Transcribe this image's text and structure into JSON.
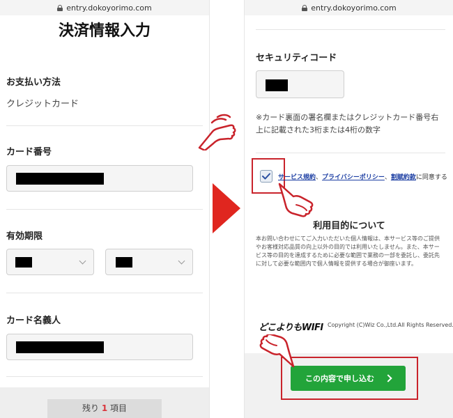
{
  "url": "entry.dokoyorimo.com",
  "left": {
    "title": "決済情報入力",
    "payment_method_label": "お支払い方法",
    "payment_method_value": "クレジットカード",
    "card_number_label": "カード番号",
    "expiry_label": "有効期限",
    "card_holder_label": "カード名義人",
    "remaining_prefix": "残り",
    "remaining_count": "1",
    "remaining_suffix": "項目"
  },
  "right": {
    "security_code_label": "セキュリティコード",
    "security_note": "※カード裏面の署名欄またはクレジットカード番号右上に記載された3桁または4桁の数字",
    "terms_link": "サービス規約",
    "privacy_link": "プライバシーポリシー",
    "cancel_link": "割賦約款",
    "separator": "、",
    "agree_suffix": "に同意する",
    "purpose_title": "利用目的について",
    "purpose_text": "本お問い合わせにてご入力いただいた個人情報は、本サービス等のご提供やお客様対応品質の向上以外の目的では利用いたしません。また、本サービス等の目的を達成するために必要な範囲で業務の一部を委託し、委託先に対して必要な範囲内で個人情報を提供する場合が御座います。",
    "logo_text": "どこよりもWIFI",
    "copyright": "Copyright (C)Wiz Co.,Ltd.All Rights Reserved.",
    "submit_label": "この内容で申し込む"
  },
  "colors": {
    "arrow_red": "#e0261f",
    "highlight_red": "#c9232b",
    "cta_green": "#22a43a",
    "link_blue": "#1d3fa3"
  }
}
